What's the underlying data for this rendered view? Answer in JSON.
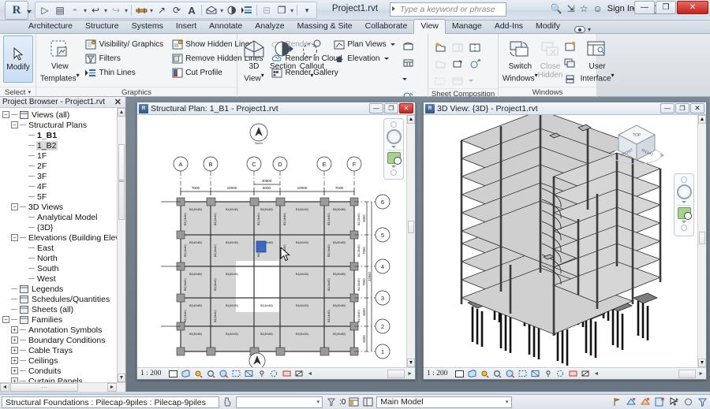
{
  "window": {
    "document_title": "Project1.rvt",
    "minimize": "—",
    "maximize": "❐",
    "close": "✕"
  },
  "quick_access": {
    "items": [
      {
        "name": "open-icon",
        "glyph": "▷"
      },
      {
        "name": "save-icon",
        "glyph": "▤"
      },
      {
        "name": "save-as-icon",
        "glyph": "◓"
      },
      {
        "name": "undo-icon",
        "glyph": "↩"
      },
      {
        "name": "redo-icon",
        "glyph": "↪"
      },
      {
        "name": "measure-icon",
        "glyph": "⇹"
      },
      {
        "name": "aligned-dimension-icon",
        "glyph": "↗"
      },
      {
        "name": "tag-icon",
        "glyph": "⟲"
      },
      {
        "name": "text-icon",
        "glyph": "A"
      },
      {
        "name": "default-3d-view-icon",
        "glyph": "⌂"
      },
      {
        "name": "section-icon",
        "glyph": "◑"
      },
      {
        "name": "thin-lines-icon",
        "glyph": "≣"
      },
      {
        "name": "close-hidden-windows-icon",
        "glyph": "⊟"
      },
      {
        "name": "switch-windows-icon",
        "glyph": "❐"
      }
    ]
  },
  "search": {
    "placeholder": "Type a keyword or phrase"
  },
  "account": {
    "search_icon": "🔍",
    "exchange_icon": "⇲",
    "favorites_icon": "☆",
    "user_icon": "☺",
    "sign_in_label": "Sign In",
    "autodesk_icon": "✕",
    "help_icon": "?"
  },
  "ribbon": {
    "tabs": [
      {
        "label": "Architecture",
        "active": false
      },
      {
        "label": "Structure",
        "active": false
      },
      {
        "label": "Systems",
        "active": false
      },
      {
        "label": "Insert",
        "active": false
      },
      {
        "label": "Annotate",
        "active": false
      },
      {
        "label": "Analyze",
        "active": false
      },
      {
        "label": "Massing & Site",
        "active": false
      },
      {
        "label": "Collaborate",
        "active": false
      },
      {
        "label": "View",
        "active": true
      },
      {
        "label": "Manage",
        "active": false
      },
      {
        "label": "Add-Ins",
        "active": false
      },
      {
        "label": "Modify",
        "active": false
      }
    ],
    "select_panel": {
      "modify_label": "Modify",
      "select_label": "Select"
    },
    "panels": [
      {
        "name": "graphics",
        "title": "Graphics",
        "big": [
          {
            "label": "View\nTemplates",
            "name": "view-templates-button"
          }
        ],
        "col1": [
          {
            "label": "Visibility/ Graphics",
            "name": "visibility-graphics-button"
          },
          {
            "label": "Filters",
            "name": "filters-button"
          },
          {
            "label": "Thin Lines",
            "name": "thin-lines-button"
          }
        ],
        "col2": [
          {
            "label": "Show Hidden Lines",
            "name": "show-hidden-lines-button"
          },
          {
            "label": "Remove Hidden Lines",
            "name": "remove-hidden-lines-button"
          },
          {
            "label": "Cut Profile",
            "name": "cut-profile-button"
          }
        ],
        "col3": [
          {
            "label": "Render",
            "name": "render-button",
            "disabled": true
          },
          {
            "label": "Render in Cloud",
            "name": "render-in-cloud-button",
            "disabled": false
          },
          {
            "label": "Render Gallery",
            "name": "render-gallery-button",
            "disabled": false
          }
        ]
      },
      {
        "name": "create",
        "title": "Create",
        "big": [
          {
            "label": "3D\nView",
            "name": "3d-view-button"
          },
          {
            "label": "Section",
            "name": "section-button"
          },
          {
            "label": "Callout",
            "name": "callout-button"
          }
        ],
        "col1": [
          {
            "label": "Plan Views",
            "name": "plan-views-button"
          },
          {
            "label": "Elevation",
            "name": "elevation-button"
          }
        ]
      },
      {
        "name": "sheet-composition",
        "title": "Sheet Composition"
      },
      {
        "name": "windows",
        "title": "Windows",
        "big": [
          {
            "label": "Switch\nWindows",
            "name": "switch-windows-button"
          },
          {
            "label": "Close\nHidden",
            "name": "close-hidden-button",
            "disabled": true
          },
          {
            "label": "User\nInterface",
            "name": "user-interface-button"
          }
        ]
      }
    ]
  },
  "project_browser": {
    "title": "Project Browser - Project1.rvt",
    "close_glyph": "✕",
    "tree": [
      {
        "label": "Views (all)",
        "depth": 0,
        "expander": "−",
        "icon": "views-icon"
      },
      {
        "label": "Structural Plans",
        "depth": 1,
        "expander": "−"
      },
      {
        "label": "1_B1",
        "depth": 2,
        "bold": true
      },
      {
        "label": "1_B2",
        "depth": 2,
        "selected": true
      },
      {
        "label": "1F",
        "depth": 2
      },
      {
        "label": "2F",
        "depth": 2
      },
      {
        "label": "3F",
        "depth": 2
      },
      {
        "label": "4F",
        "depth": 2
      },
      {
        "label": "5F",
        "depth": 2
      },
      {
        "label": "3D Views",
        "depth": 1,
        "expander": "−"
      },
      {
        "label": "Analytical Model",
        "depth": 2
      },
      {
        "label": "{3D}",
        "depth": 2
      },
      {
        "label": "Elevations (Building Elevation",
        "depth": 1,
        "expander": "−"
      },
      {
        "label": "East",
        "depth": 2
      },
      {
        "label": "North",
        "depth": 2
      },
      {
        "label": "South",
        "depth": 2
      },
      {
        "label": "West",
        "depth": 2
      },
      {
        "label": "Legends",
        "depth": 0,
        "icon": "legend-icon"
      },
      {
        "label": "Schedules/Quantities",
        "depth": 0,
        "icon": "schedule-icon"
      },
      {
        "label": "Sheets (all)",
        "depth": 0,
        "icon": "sheet-icon"
      },
      {
        "label": "Families",
        "depth": 0,
        "expander": "−",
        "icon": "families-icon"
      },
      {
        "label": "Annotation Symbols",
        "depth": 1,
        "expander": "+"
      },
      {
        "label": "Boundary Conditions",
        "depth": 1,
        "expander": "+"
      },
      {
        "label": "Cable Trays",
        "depth": 1,
        "expander": "+"
      },
      {
        "label": "Ceilings",
        "depth": 1,
        "expander": "+"
      },
      {
        "label": "Conduits",
        "depth": 1,
        "expander": "+"
      },
      {
        "label": "Curtain Panels",
        "depth": 1,
        "expander": "+"
      }
    ]
  },
  "plan_window": {
    "title": "Structural Plan: 1_B1 - Project1.rvt",
    "minimize": "—",
    "maximize": "❐",
    "close": "✕",
    "scale": "1 : 200",
    "grid_letters": [
      "A",
      "B",
      "C",
      "D",
      "E",
      "F"
    ],
    "grid_numbers": [
      "6",
      "5",
      "4",
      "3",
      "2",
      "1"
    ],
    "dimensions_top": [
      "7000",
      "10000",
      "6000",
      "10000",
      "7000"
    ],
    "overall_dimension": "40000",
    "beam_tags": [
      "B2(40x80)",
      "B1(40x30)",
      "B2(40x80)",
      "B1(40x30)",
      "B2(40x80)"
    ],
    "column_tags": [
      "B2(14x80)",
      "B2(18x80)",
      "B2(14x80)",
      "B2(14x80)",
      "B2(14x80)",
      "B2(18x80)"
    ],
    "north_label": "North",
    "view_controls": [
      {
        "name": "scale-control",
        "glyph": "▭"
      },
      {
        "name": "detail-level-icon",
        "glyph": "◫"
      },
      {
        "name": "visual-style-icon",
        "glyph": "◔"
      },
      {
        "name": "sun-path-icon",
        "glyph": "☼"
      },
      {
        "name": "shadows-icon",
        "glyph": "◐"
      },
      {
        "name": "render-dialog-icon",
        "glyph": "◉"
      },
      {
        "name": "crop-view-icon",
        "glyph": "⬚"
      },
      {
        "name": "show-crop-region-icon",
        "glyph": "⬛"
      },
      {
        "name": "lock-3d-view-icon",
        "glyph": "⚿"
      },
      {
        "name": "temporary-hide-isolate-icon",
        "glyph": "◍"
      },
      {
        "name": "reveal-hidden-elements-icon",
        "glyph": "▣"
      },
      {
        "name": "analytical-model-icon",
        "glyph": "▨"
      }
    ]
  },
  "view3d_window": {
    "title": "3D View: {3D} - Project1.rvt",
    "minimize": "—",
    "maximize": "❐",
    "close": "✕",
    "scale": "1 : 200",
    "viewcube": {
      "top": "TOP",
      "front": "FRONT",
      "right": "RIGHT"
    },
    "navbar": {
      "wheel": "steering-wheel-icon",
      "zoom": "zoom-tool-icon"
    }
  },
  "status_bar": {
    "selection": "Structural Foundations : Pilecap-9piles : Pilecap-9piles",
    "filter_count": ":0",
    "worksets_value": "Main Model",
    "press_tab_icon": "⛏",
    "right_icons": [
      {
        "name": "main-model-icon",
        "glyph": "⚐"
      },
      {
        "name": "design-options-icon",
        "glyph": "◮"
      },
      {
        "name": "exclude-options-icon",
        "glyph": "◭"
      },
      {
        "name": "active-only-icon",
        "glyph": "◪"
      },
      {
        "name": "select-links-icon",
        "glyph": "⤧"
      },
      {
        "name": "select-pinned-icon",
        "glyph": "◯"
      },
      {
        "name": "filter-icon",
        "glyph": "▽"
      }
    ]
  }
}
